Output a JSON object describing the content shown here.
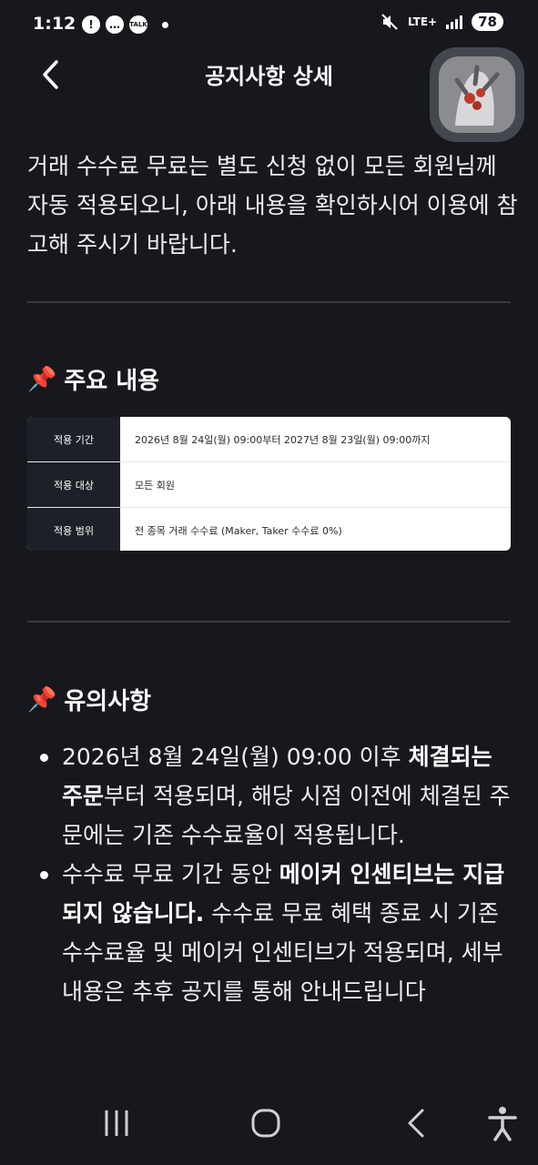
{
  "status_bar": {
    "time": "1:12",
    "notif_icons": [
      "!",
      "…",
      "TALK"
    ],
    "network": "LTE+",
    "battery": "78"
  },
  "header": {
    "title": "공지사항 상세"
  },
  "intro": "거래 수수료 무료는 별도 신청 없이 모든 회원님께 자동 적용되오니, 아래 내용을 확인하시어 이용에 참고해 주시기 바랍니다.",
  "section_main": {
    "emoji": "📌",
    "title": "주요 내용",
    "table": [
      {
        "label": "적용 기간",
        "value": "2026년 8월 24일(월) 09:00부터 2027년 8월 23일(월) 09:00까지"
      },
      {
        "label": "적용 대상",
        "value": "모든 회원"
      },
      {
        "label": "적용 범위",
        "value": "전 종목 거래 수수료 (Maker, Taker 수수료 0%)"
      }
    ]
  },
  "section_notes": {
    "emoji": "📌",
    "title": "유의사항",
    "bullets": [
      {
        "pre": "2026년 8월 24일(월) 09:00 이후 ",
        "bold": "체결되는 주문",
        "post": "부터 적용되며, 해당 시점 이전에 체결된 주문에는 기존 수수료율이 적용됩니다."
      },
      {
        "pre": "수수료 무료 기간 동안 ",
        "bold": "메이커 인센티브는 지급되지 않습니다.",
        "post": " 수수료 무료 혜택 종료 시 기존 수수료율 및 메이커 인센티브가 적용되며, 세부 내용은 추후 공지를 통해 안내드립니다"
      }
    ]
  },
  "colors": {
    "background": "#17181d",
    "table_header_bg": "#1d2027",
    "table_body_bg": "#ffffff",
    "divider": "#3a3b42"
  }
}
